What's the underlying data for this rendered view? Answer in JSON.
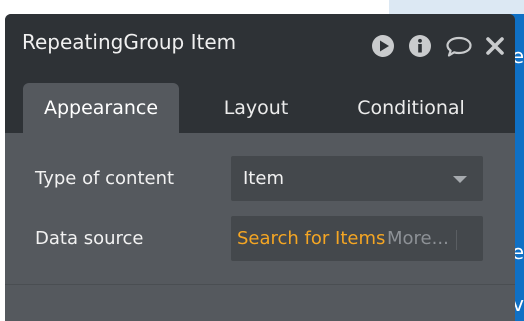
{
  "background": {
    "accent": "#0f70c5",
    "letters": [
      "e",
      "e",
      "v"
    ]
  },
  "panel": {
    "title": "RepeatingGroup Item",
    "header_icons": [
      "play-icon",
      "info-icon",
      "comment-icon",
      "close-icon"
    ],
    "colors": {
      "header": "#2e3236",
      "body": "#55595e",
      "field": "#44484c",
      "link": "#f5a623"
    }
  },
  "tabs": [
    {
      "label": "Appearance",
      "active": true
    },
    {
      "label": "Layout",
      "active": false
    },
    {
      "label": "Conditional",
      "active": false
    }
  ],
  "fields": {
    "type_of_content": {
      "label": "Type of content",
      "value": "Item"
    },
    "data_source": {
      "label": "Data source",
      "value": "Search for Items",
      "more": "More..."
    }
  }
}
